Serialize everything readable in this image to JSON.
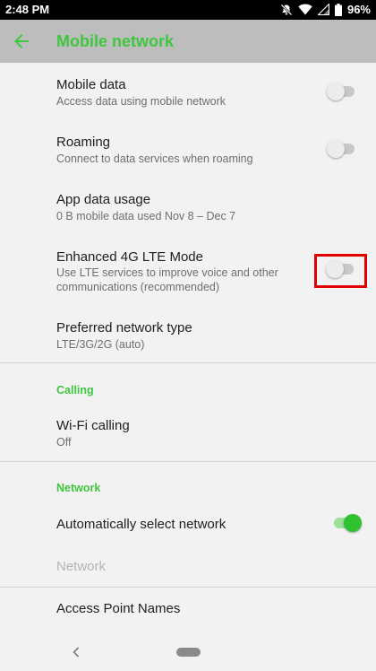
{
  "status_bar": {
    "time": "2:48 PM",
    "battery": "96%"
  },
  "app_bar": {
    "title": "Mobile network"
  },
  "prefs": {
    "mobile_data": {
      "title": "Mobile data",
      "summary": "Access data using mobile network",
      "enabled": false
    },
    "roaming": {
      "title": "Roaming",
      "summary": "Connect to data services when roaming",
      "enabled": false
    },
    "app_data_usage": {
      "title": "App data usage",
      "summary": "0 B mobile data used Nov 8 – Dec 7"
    },
    "lte_mode": {
      "title": "Enhanced 4G LTE Mode",
      "summary": "Use LTE services to improve voice and other communications (recommended)",
      "enabled": false
    },
    "preferred_network": {
      "title": "Preferred network type",
      "summary": "LTE/3G/2G (auto)"
    },
    "wifi_calling": {
      "title": "Wi-Fi calling",
      "summary": "Off"
    },
    "auto_select": {
      "title": "Automatically select network",
      "enabled": true
    },
    "network": {
      "title": "Network"
    },
    "apn": {
      "title": "Access Point Names"
    }
  },
  "categories": {
    "calling": "Calling",
    "network": "Network"
  },
  "colors": {
    "accent": "#3ec73e",
    "app_bar": "#bdbdbd",
    "highlight": "#e00000"
  }
}
